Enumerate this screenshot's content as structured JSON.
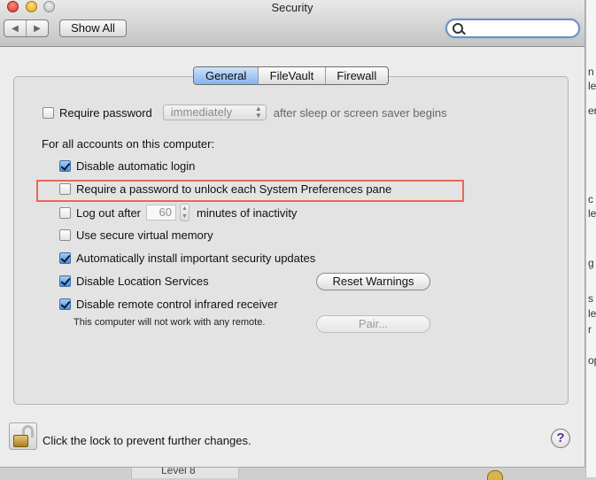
{
  "window": {
    "title": "Security",
    "nav_back": "◀",
    "nav_forward": "▶",
    "show_all_label": "Show All",
    "search": {
      "value": "",
      "placeholder": ""
    }
  },
  "tabs": [
    {
      "label": "General",
      "selected": true
    },
    {
      "label": "FileVault",
      "selected": false
    },
    {
      "label": "Firewall",
      "selected": false
    }
  ],
  "general": {
    "require_password": {
      "label": "Require password",
      "checked": false,
      "popup_value": "immediately",
      "suffix": "after sleep or screen saver begins"
    },
    "all_accounts_heading": "For all accounts on this computer:",
    "options": [
      {
        "label": "Disable automatic login",
        "checked": true
      },
      {
        "label": "Require a password to unlock each System Preferences pane",
        "checked": false
      },
      {
        "label": "Log out after",
        "checked": false,
        "value": "60",
        "suffix": "minutes of inactivity"
      },
      {
        "label": "Use secure virtual memory",
        "checked": false
      },
      {
        "label": "Automatically install important security updates",
        "checked": true
      },
      {
        "label": "Disable Location Services",
        "checked": true
      },
      {
        "label": "Disable remote control infrared receiver",
        "checked": true
      }
    ],
    "reset_warnings_label": "Reset Warnings",
    "remote_note": "This computer will not work with any remote.",
    "pair_label": "Pair..."
  },
  "bottom": {
    "lock_text": "Click the lock to prevent further changes.",
    "help_label": "?"
  },
  "background": {
    "fragments": [
      "n",
      "le",
      "er",
      "c",
      "le",
      "g",
      "s",
      "le",
      "r",
      "ор"
    ],
    "level_label": "Level 8"
  },
  "colors": {
    "selection_accent": "#82b3ef",
    "highlight_box": "#e8675a",
    "checkbox_checked": "#4a8fdd"
  }
}
